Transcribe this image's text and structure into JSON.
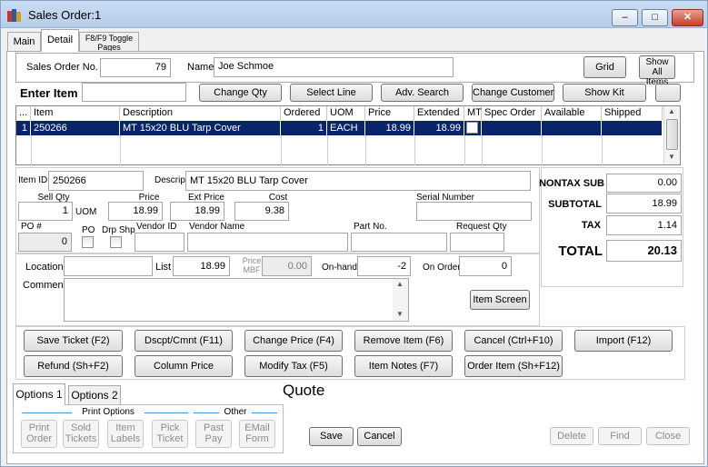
{
  "window": {
    "title": "Sales Order:1",
    "min": "–",
    "max": "□",
    "close": "✕"
  },
  "tabs": {
    "main": "Main",
    "detail": "Detail",
    "toggle": "F8/F9 Toggle Pages"
  },
  "header": {
    "order_no_label": "Sales Order No.",
    "order_no": "79",
    "name_label": "Name",
    "name": "Joe Schmoe",
    "grid_btn": "Grid",
    "show_all": "Show All Items"
  },
  "enter_item": {
    "label": "Enter Item",
    "value": "",
    "buttons": [
      "Change Qty",
      "Select Line",
      "Adv. Search",
      "Change Customer",
      "Show Kit",
      ""
    ]
  },
  "grid": {
    "columns": [
      "...",
      "Item",
      "Description",
      "Ordered",
      "UOM",
      "Price",
      "Extended",
      "MT",
      "Spec Order",
      "Available",
      "Shipped"
    ],
    "rows": [
      {
        "n": "1",
        "item": "250266",
        "desc": "MT 15x20 BLU Tarp Cover",
        "ordered": "1",
        "uom": "EACH",
        "price": "18.99",
        "extended": "18.99",
        "mt": "",
        "spec": "",
        "avail": "",
        "shipped": ""
      }
    ]
  },
  "detail": {
    "item_id_label": "Item ID",
    "item_id": "250266",
    "descrip_label": "Descrip",
    "descrip": "MT 15x20 BLU Tarp Cover",
    "sell_qty_label": "Sell Qty",
    "sell_qty": "1",
    "uom": "UOM",
    "price_label": "Price",
    "price": "18.99",
    "ext_price_label": "Ext Price",
    "ext_price": "18.99",
    "cost_label": "Cost",
    "cost": "9.38",
    "serial_label": "Serial Number",
    "serial": "",
    "po_num_label": "PO #",
    "po_num": "0",
    "po_label": "PO",
    "drpshp_label": "Drp Shp",
    "vendor_id_label": "Vendor ID",
    "vendor_name_label": "Vendor Name",
    "part_no_label": "Part No.",
    "request_qty_label": "Request Qty",
    "location_label": "Location",
    "list_label": "List",
    "list": "18.99",
    "price_mbf_label": "Price MBF",
    "price_mbf": "0.00",
    "onhand_label": "On-hand",
    "onhand": "-2",
    "onorder_label": "On Order",
    "onorder": "0",
    "comment_label": "Comment",
    "item_screen": "Item Screen"
  },
  "totals": {
    "nontax_label": "NONTAX SUB",
    "nontax": "0.00",
    "subtotal_label": "SUBTOTAL",
    "subtotal": "18.99",
    "tax_label": "TAX",
    "tax": "1.14",
    "total_label": "TOTAL",
    "total": "20.13"
  },
  "actions": {
    "row1": [
      "Save Ticket (F2)",
      "Dscpt/Cmnt (F11)",
      "Change Price (F4)",
      "Remove Item (F6)",
      "Cancel (Ctrl+F10)",
      "Import (F12)"
    ],
    "row2": [
      "Refund (Sh+F2)",
      "Column Price",
      "Modify Tax (F5)",
      "Item Notes (F7)",
      "Order Item (Sh+F12)"
    ]
  },
  "status": "Quote",
  "options": {
    "tab1": "Options 1",
    "tab2": "Options 2",
    "print_options": "Print Options",
    "other": "Other",
    "buttons": [
      {
        "l1": "Print",
        "l2": "Order"
      },
      {
        "l1": "Sold",
        "l2": "Tickets"
      },
      {
        "l1": "Item",
        "l2": "Labels"
      },
      {
        "l1": "Pick",
        "l2": "Ticket"
      },
      {
        "l1": "Past",
        "l2": "Pay"
      },
      {
        "l1": "EMail",
        "l2": "Form"
      }
    ]
  },
  "footer": {
    "save": "Save",
    "cancel": "Cancel",
    "delete": "Delete",
    "find": "Find",
    "close": "Close"
  },
  "colors": {
    "selection": "#0a246a",
    "title_bg": "#c9dcf3"
  }
}
